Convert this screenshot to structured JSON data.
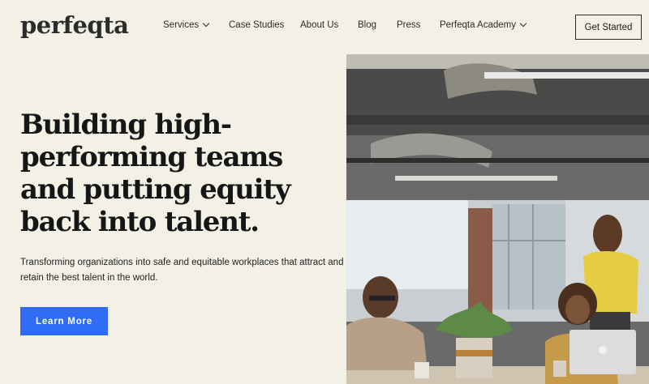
{
  "brand": {
    "logo": "perfeqta"
  },
  "nav": {
    "items": [
      {
        "label": "Services",
        "dropdown": true
      },
      {
        "label": "Case Studies",
        "dropdown": false
      },
      {
        "label": "About Us",
        "dropdown": false
      },
      {
        "label": "Blog",
        "dropdown": false
      },
      {
        "label": "Press",
        "dropdown": false
      },
      {
        "label": "Perfeqta Academy",
        "dropdown": true
      }
    ],
    "cta_label": "Get Started"
  },
  "hero": {
    "title_lines": [
      "Building high-",
      "performing teams",
      "and putting equity",
      "back into talent."
    ],
    "subtitle_lines": [
      "Transforming organizations into safe and equitable workplaces that attract and",
      "retain the best talent in the world."
    ],
    "button_label": "Learn More"
  },
  "colors": {
    "background": "#f3f1e6",
    "accent": "#2f6bf3",
    "text": "#161616"
  }
}
